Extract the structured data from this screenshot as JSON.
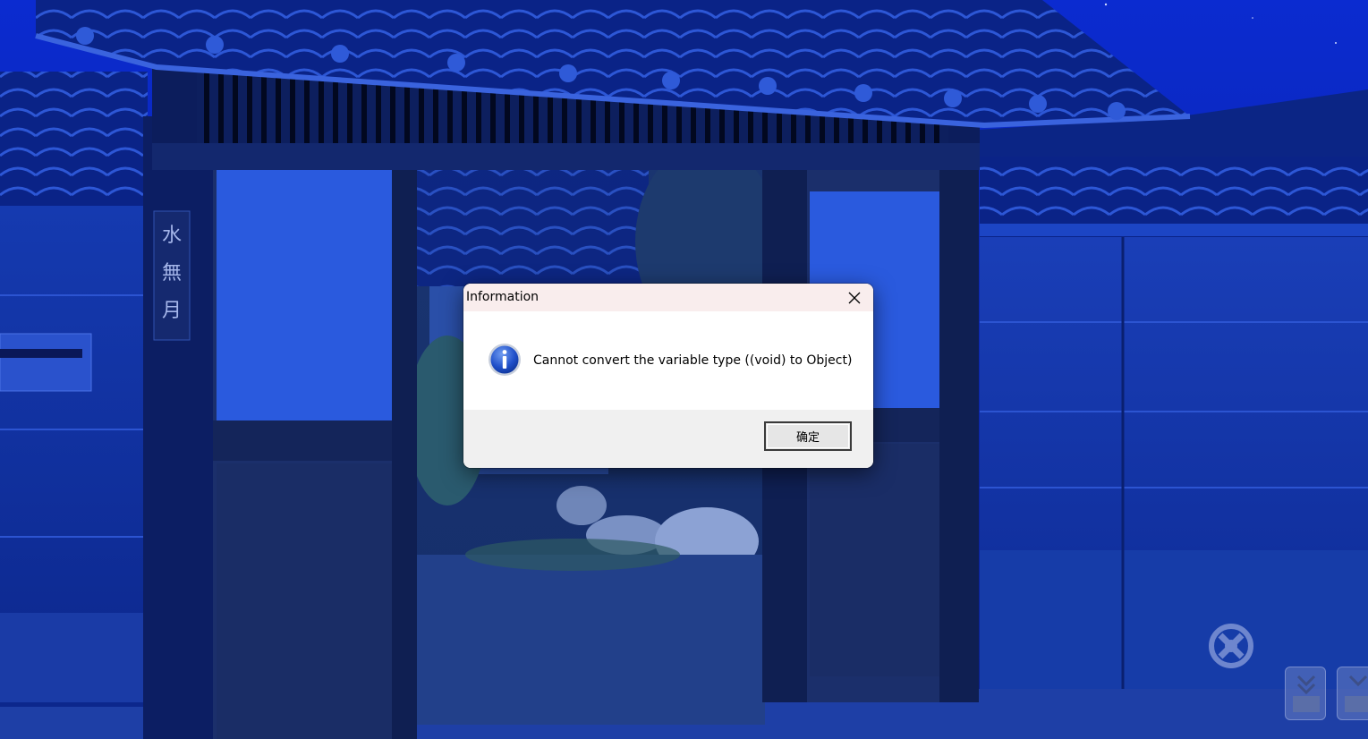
{
  "window": {
    "background_scene": "night-japanese-gate"
  },
  "scene": {
    "plaque_text": "水無月"
  },
  "dialog": {
    "title": "Information",
    "message": "Cannot convert the variable type ((void) to Object)",
    "ok_label": "确定",
    "icon": "info-icon",
    "close_icon": "close-icon"
  },
  "hud": {
    "logo_icon": "game-logo-icon",
    "buttons": [
      {
        "icon": "quick-save-icon"
      },
      {
        "icon": "quick-load-icon"
      }
    ]
  },
  "colors": {
    "title_bar": "#f9eded",
    "footer": "#f0f0f0",
    "scene_blue": "#0a2a9a",
    "info_blue": "#1f4fc9"
  }
}
